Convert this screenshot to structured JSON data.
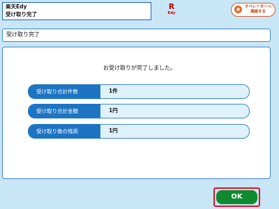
{
  "header": {
    "brand": "楽天Edy",
    "screen_name": "受け取り完了"
  },
  "logo": {
    "mark": "R",
    "sub": "Edy"
  },
  "operator_button": {
    "line1": "オペレーターへ",
    "line2": "連絡する",
    "icon": "operator-face-icon"
  },
  "title_bar": {
    "title": "受け取り完了"
  },
  "main": {
    "message": "お受け取りが完了しました。",
    "rows": [
      {
        "label": "受け取り合計件数",
        "value": "1件"
      },
      {
        "label": "受け取り合計金額",
        "value": "1円"
      },
      {
        "label": "受け取り後の残高",
        "value": "1円"
      }
    ]
  },
  "footer": {
    "ok_label": "OK"
  },
  "colors": {
    "background": "#c9e6f7",
    "accent_blue": "#1d74c2",
    "ok_green": "#0f8a2e",
    "highlight_red": "#e0102a",
    "brand_red": "#bf0000"
  }
}
